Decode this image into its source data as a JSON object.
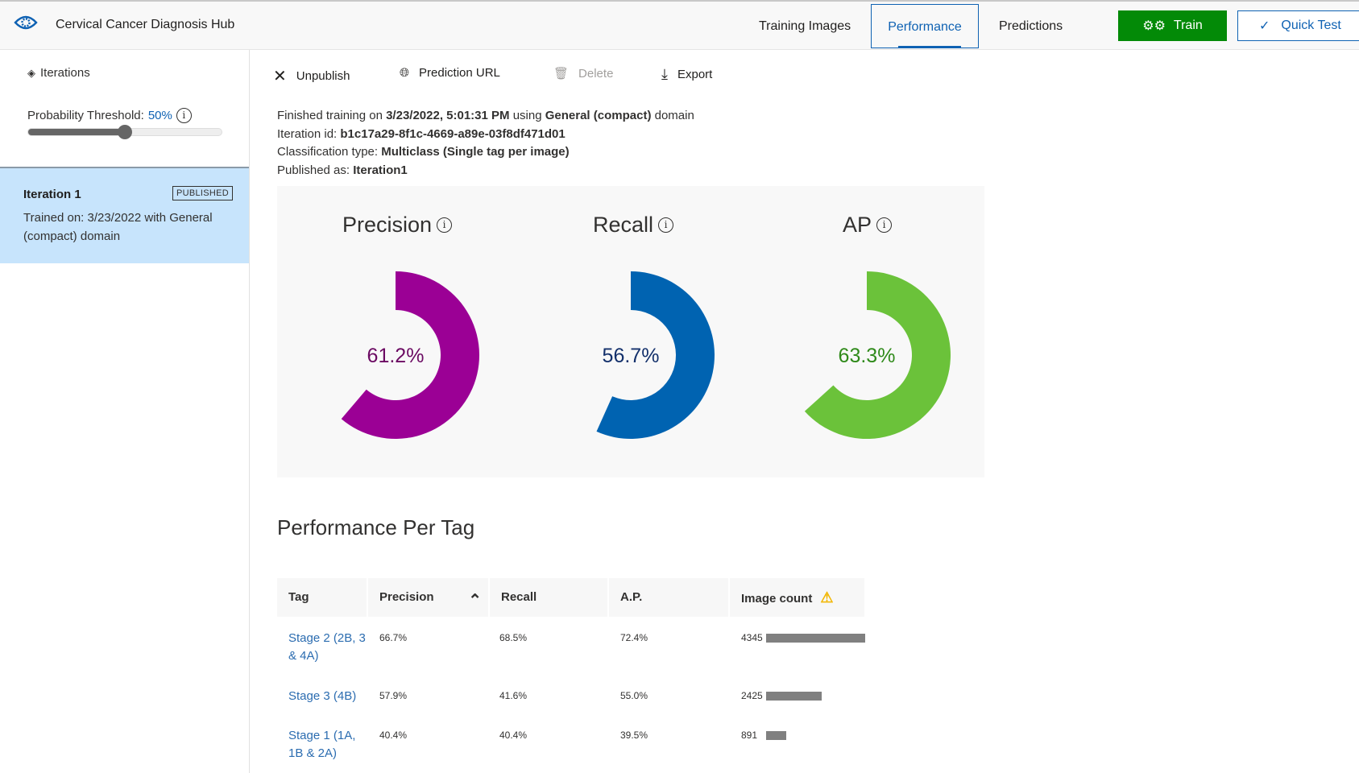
{
  "header": {
    "title": "Cervical Cancer Diagnosis Hub",
    "tabs": [
      {
        "label": "Training Images"
      },
      {
        "label": "Performance",
        "active": true
      },
      {
        "label": "Predictions"
      }
    ],
    "train_label": "Train",
    "quick_test_label": "Quick Test",
    "accent": "#0f62b3",
    "train_color": "#038a07"
  },
  "sidebar": {
    "iterations_label": "Iterations",
    "threshold_label": "Probability Threshold:",
    "threshold_value": "50%",
    "threshold_fraction": 0.5,
    "iteration": {
      "name": "Iteration 1",
      "badge": "PUBLISHED",
      "description": "Trained on: 3/23/2022 with General (compact) domain"
    }
  },
  "toolbar": {
    "unpublish": "Unpublish",
    "prediction_url": "Prediction URL",
    "delete": "Delete",
    "export": "Export"
  },
  "meta": {
    "l1a": "Finished training on ",
    "l1b": "3/23/2022, 5:01:31 PM",
    "l1c": " using ",
    "l1d": "General (compact)",
    "l1e": " domain",
    "l2a": "Iteration id: ",
    "l2b": "b1c17a29-8f1c-4669-a89e-03f8df471d01",
    "l3a": "Classification type: ",
    "l3b": "Multiclass (Single tag per image)",
    "l4a": "Published as: ",
    "l4b": "Iteration1"
  },
  "metrics": [
    {
      "name": "Precision",
      "value": 61.2,
      "label": "61.2%",
      "color": "#9b0095",
      "text_color": "#6b0a62"
    },
    {
      "name": "Recall",
      "value": 56.7,
      "label": "56.7%",
      "color": "#0063b1",
      "text_color": "#13306b"
    },
    {
      "name": "AP",
      "value": 63.3,
      "label": "63.3%",
      "color": "#6bc23a",
      "text_color": "#2f8a1a"
    }
  ],
  "per_tag": {
    "title": "Performance Per Tag",
    "columns": [
      "Tag",
      "Precision",
      "Recall",
      "A.P.",
      "Image count"
    ],
    "rows": [
      {
        "tag": "Stage 2 (2B, 3 & 4A)",
        "precision": "66.7%",
        "recall": "68.5%",
        "ap": "72.4%",
        "count": "4345",
        "n": 4345
      },
      {
        "tag": "Stage 3 (4B)",
        "precision": "57.9%",
        "recall": "41.6%",
        "ap": "55.0%",
        "count": "2425",
        "n": 2425
      },
      {
        "tag": "Stage 1 (1A, 1B & 2A)",
        "precision": "40.4%",
        "recall": "40.4%",
        "ap": "39.5%",
        "count": "891",
        "n": 891
      }
    ]
  }
}
